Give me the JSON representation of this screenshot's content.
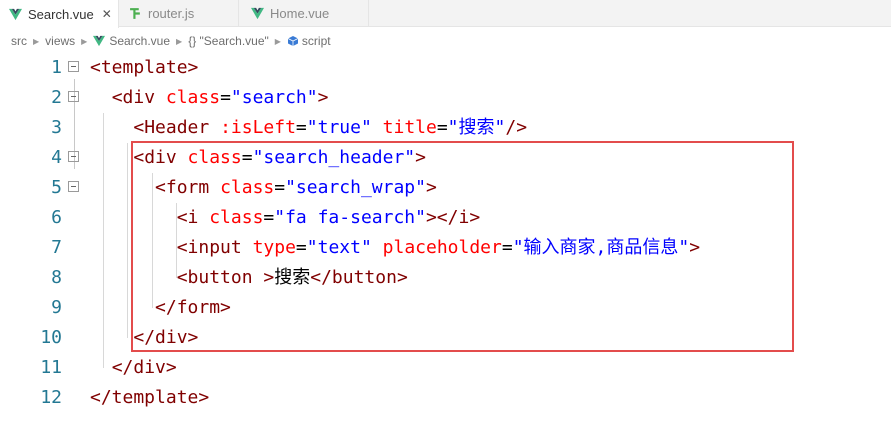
{
  "tabs": [
    {
      "label": "Search.vue",
      "active": true,
      "icon": "vue-icon",
      "close": "✕"
    },
    {
      "label": "router.js",
      "active": false,
      "icon": "js-icon"
    },
    {
      "label": "Home.vue",
      "active": false,
      "icon": "vue-icon"
    }
  ],
  "breadcrumb": {
    "items": [
      "src",
      "views",
      "Search.vue",
      "{} \"Search.vue\"",
      "script"
    ]
  },
  "lines": [
    {
      "num": "1",
      "tokens": [
        [
          "t",
          "<template>"
        ]
      ]
    },
    {
      "num": "2",
      "tokens": [
        [
          "x",
          "  "
        ],
        [
          "t",
          "<div "
        ],
        [
          "a",
          "class"
        ],
        [
          "p",
          "="
        ],
        [
          "s",
          "\"search\""
        ],
        [
          "t",
          ">"
        ]
      ]
    },
    {
      "num": "3",
      "tokens": [
        [
          "x",
          "    "
        ],
        [
          "t",
          "<Header "
        ],
        [
          "a",
          ":isLeft"
        ],
        [
          "p",
          "="
        ],
        [
          "s",
          "\"true\""
        ],
        [
          "x",
          " "
        ],
        [
          "a",
          "title"
        ],
        [
          "p",
          "="
        ],
        [
          "s",
          "\"搜索\""
        ],
        [
          "t",
          "/>"
        ]
      ]
    },
    {
      "num": "4",
      "tokens": [
        [
          "x",
          "    "
        ],
        [
          "t",
          "<div "
        ],
        [
          "a",
          "class"
        ],
        [
          "p",
          "="
        ],
        [
          "s",
          "\"search_header\""
        ],
        [
          "t",
          ">"
        ]
      ]
    },
    {
      "num": "5",
      "tokens": [
        [
          "x",
          "      "
        ],
        [
          "t",
          "<form "
        ],
        [
          "a",
          "class"
        ],
        [
          "p",
          "="
        ],
        [
          "s",
          "\"search_wrap\""
        ],
        [
          "t",
          ">"
        ]
      ]
    },
    {
      "num": "6",
      "tokens": [
        [
          "x",
          "        "
        ],
        [
          "t",
          "<i "
        ],
        [
          "a",
          "class"
        ],
        [
          "p",
          "="
        ],
        [
          "s",
          "\"fa fa-search\""
        ],
        [
          "t",
          "></i>"
        ]
      ]
    },
    {
      "num": "7",
      "tokens": [
        [
          "x",
          "        "
        ],
        [
          "t",
          "<input "
        ],
        [
          "a",
          "type"
        ],
        [
          "p",
          "="
        ],
        [
          "s",
          "\"text\""
        ],
        [
          "x",
          " "
        ],
        [
          "a",
          "placeholder"
        ],
        [
          "p",
          "="
        ],
        [
          "s",
          "\"输入商家,商品信息\""
        ],
        [
          "t",
          ">"
        ]
      ]
    },
    {
      "num": "8",
      "tokens": [
        [
          "x",
          "        "
        ],
        [
          "t",
          "<button "
        ],
        [
          "t",
          ">"
        ],
        [
          "x",
          "搜索"
        ],
        [
          "t",
          "</button>"
        ]
      ]
    },
    {
      "num": "9",
      "tokens": [
        [
          "x",
          "      "
        ],
        [
          "t",
          "</form>"
        ]
      ]
    },
    {
      "num": "10",
      "tokens": [
        [
          "x",
          "    "
        ],
        [
          "t",
          "</div>"
        ]
      ]
    },
    {
      "num": "11",
      "tokens": [
        [
          "x",
          "  "
        ],
        [
          "t",
          "</div>"
        ]
      ]
    },
    {
      "num": "12",
      "tokens": [
        [
          "t",
          "</template>"
        ]
      ]
    }
  ],
  "colors": {
    "tag": "#800000",
    "attribute": "#ff0000",
    "string": "#0000ff",
    "line_number": "#237893",
    "highlight_box": "#e34c4c"
  }
}
